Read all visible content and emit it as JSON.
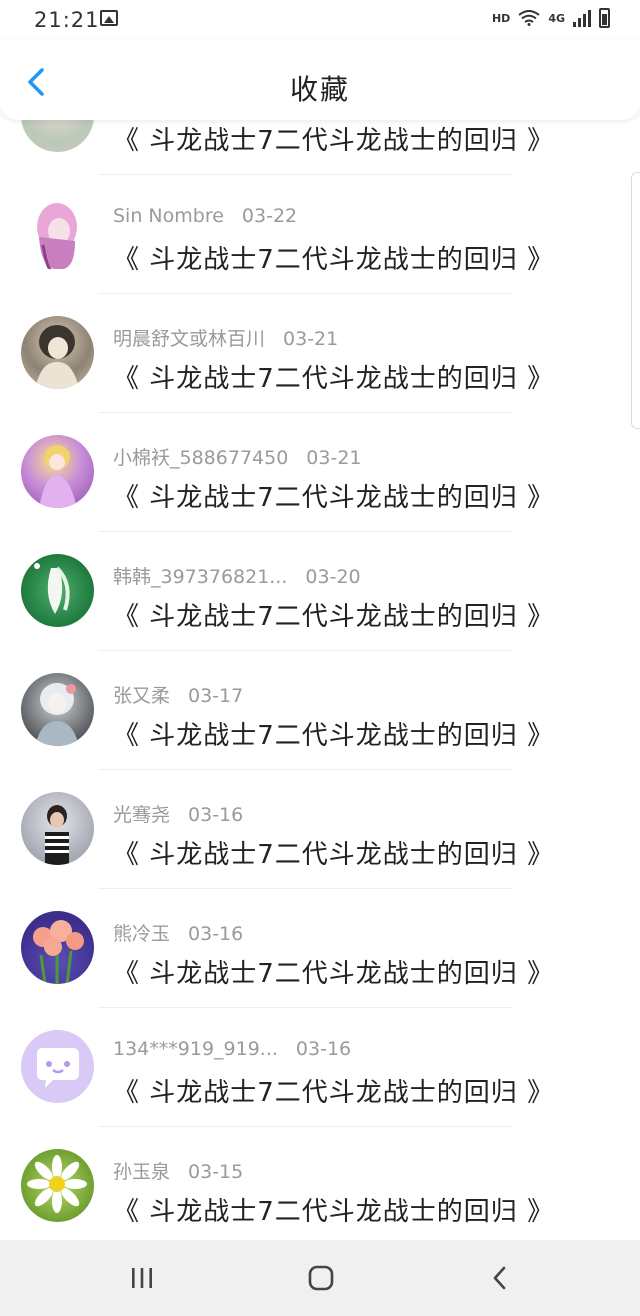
{
  "status_bar": {
    "time": "21:21",
    "network_label": "HD",
    "cellular_label": "4G"
  },
  "header": {
    "title": "收藏",
    "back_icon": "chevron-left-icon",
    "accent_color": "#2196f3"
  },
  "list": {
    "items": [
      {
        "username": "",
        "date": "",
        "comment": "《 斗龙战士7二代斗龙战士的回归 》",
        "avatar": "pastel-illustration"
      },
      {
        "username": "Sin Nombre",
        "date": "03-22",
        "comment": "《 斗龙战士7二代斗龙战士的回归 》",
        "avatar": "pink-hair-girl"
      },
      {
        "username": "明晨舒文或林百川",
        "date": "03-21",
        "comment": "《 斗龙战士7二代斗龙战士的回归 》",
        "avatar": "sepia-anime-girl"
      },
      {
        "username": "小棉袄_588677450",
        "date": "03-21",
        "comment": "《 斗龙战士7二代斗龙战士的回归 》",
        "avatar": "purple-fairy"
      },
      {
        "username": "韩韩_397376821...",
        "date": "03-20",
        "comment": "《 斗龙战士7二代斗龙战士的回归 》",
        "avatar": "green-flower"
      },
      {
        "username": "张又柔",
        "date": "03-17",
        "comment": "《 斗龙战士7二代斗龙战士的回归 》",
        "avatar": "dark-anime-girl"
      },
      {
        "username": "光骞尧",
        "date": "03-16",
        "comment": "《 斗龙战士7二代斗龙战士的回归 》",
        "avatar": "boy-photo"
      },
      {
        "username": "熊冷玉",
        "date": "03-16",
        "comment": "《 斗龙战士7二代斗龙战士的回归 》",
        "avatar": "pink-flowers"
      },
      {
        "username": "134***919_919...",
        "date": "03-16",
        "comment": "《 斗龙战士7二代斗龙战士的回归 》",
        "avatar": "default-chat-bubble"
      },
      {
        "username": "孙玉泉",
        "date": "03-15",
        "comment": "《 斗龙战士7二代斗龙战士的回归 》",
        "avatar": "daisy"
      }
    ]
  },
  "nav_bar": {
    "recent_icon": "recent-apps-icon",
    "home_icon": "home-icon",
    "back_icon": "back-icon"
  }
}
